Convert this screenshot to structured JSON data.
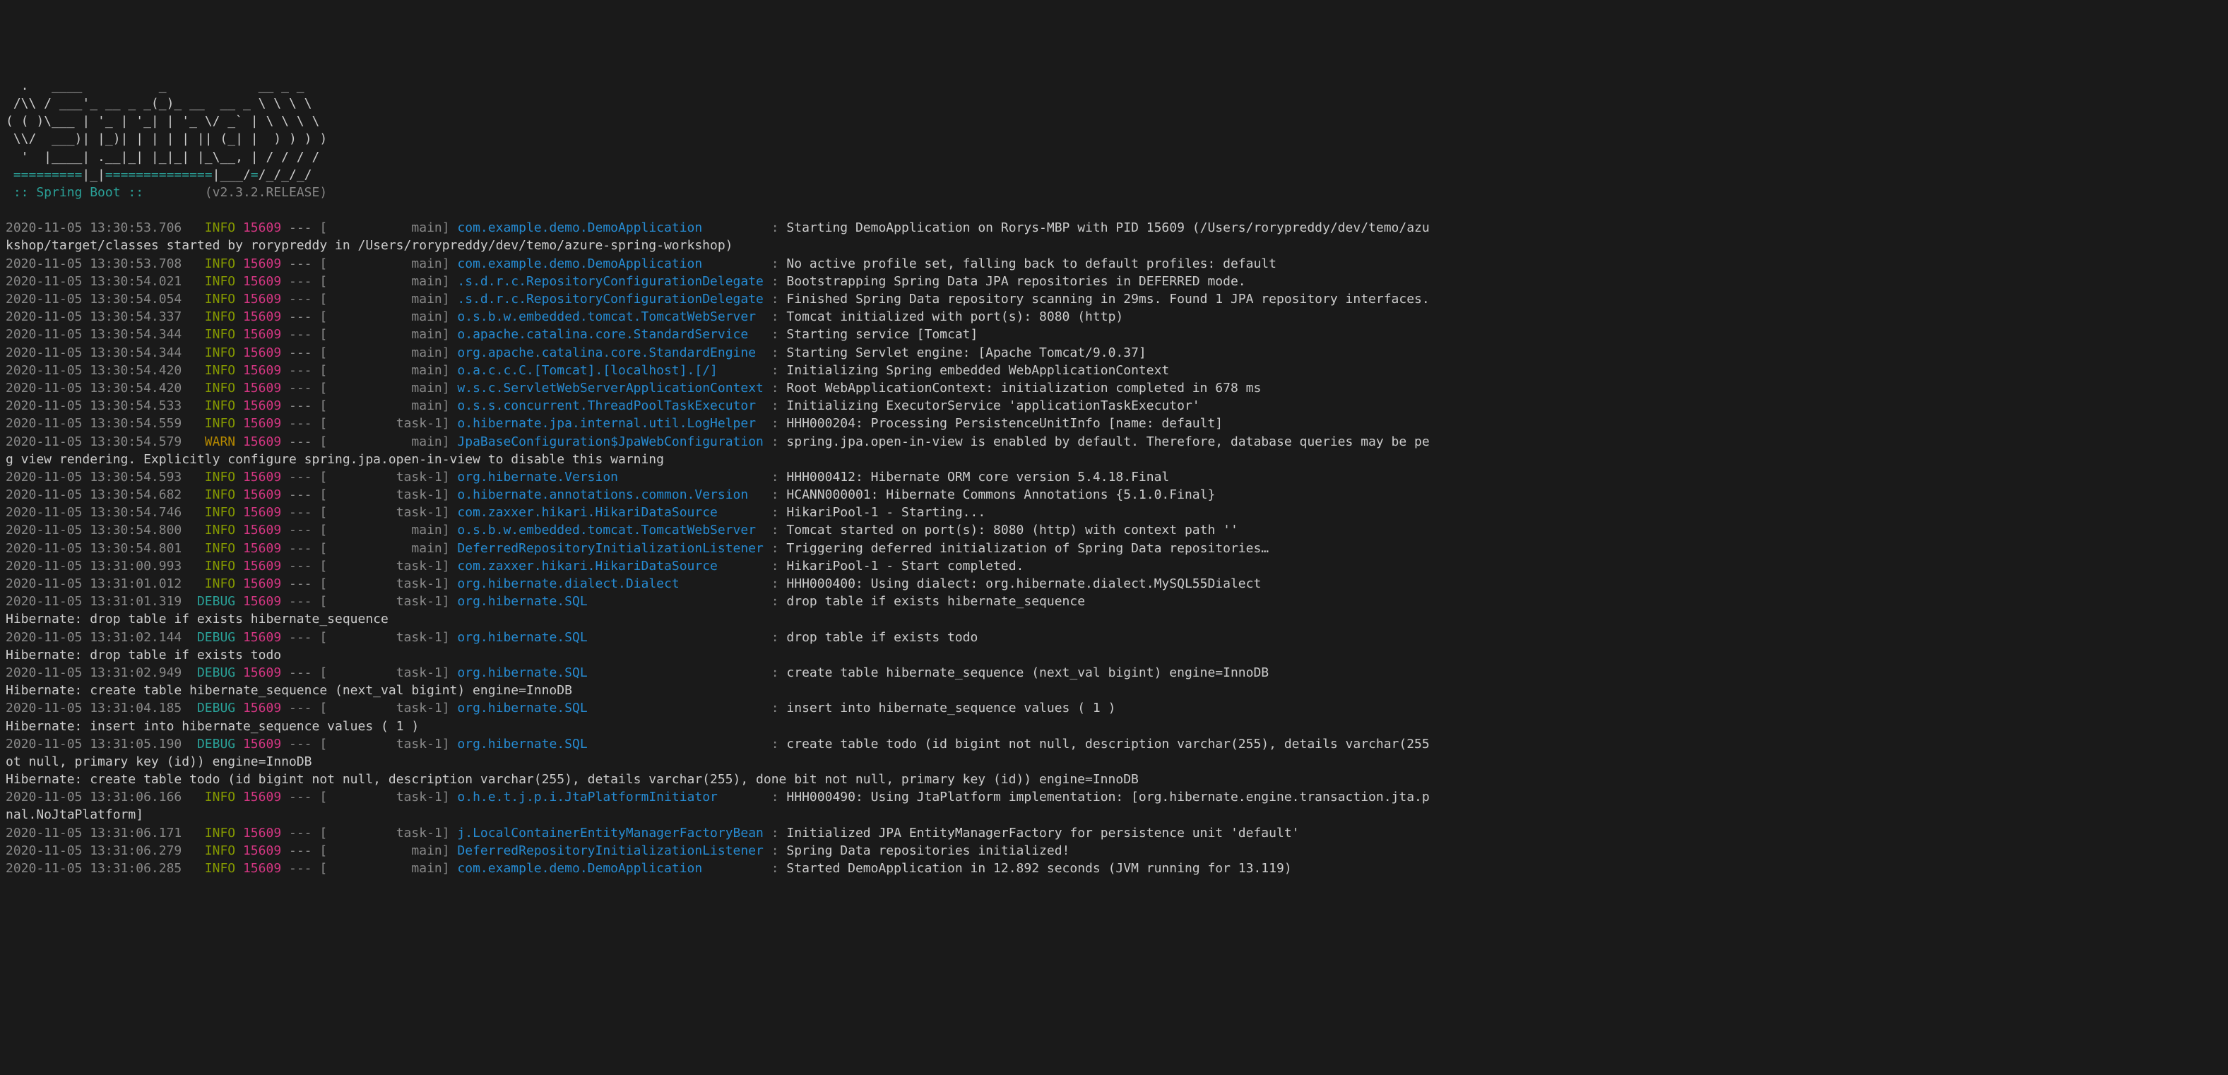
{
  "banner": {
    "line1": "  .   ____          _            __ _ _",
    "line2": " /\\\\ / ___'_ __ _ _(_)_ __  __ _ \\ \\ \\ \\",
    "line3": "( ( )\\___ | '_ | '_| | '_ \\/ _` | \\ \\ \\ \\",
    "line4": " \\\\/  ___)| |_)| | | | | || (_| |  ) ) ) )",
    "line5": "  '  |____| .__|_| |_|_| |_\\__, | / / / /",
    "eq": " =========",
    "eq2": "|_|",
    "eq3": "==============",
    "eq4": "|___/",
    "eq5": "=",
    "slashes": "/_/_/_/",
    "boot": " :: Spring Boot ::        ",
    "version": "(v2.3.2.RELEASE)"
  },
  "entries": [
    {
      "ts": "2020-11-05 13:30:53.706",
      "lvl": "INFO",
      "pid": "15609",
      "sep": "--- [",
      "thread": "           main]",
      "logger": "com.example.demo.DemoApplication        ",
      "msg": "Starting DemoApplication on Rorys-MBP with PID 15609 (/Users/rorypreddy/dev/temo/azu"
    },
    {
      "raw": "kshop/target/classes started by rorypreddy in /Users/rorypreddy/dev/temo/azure-spring-workshop)"
    },
    {
      "ts": "2020-11-05 13:30:53.708",
      "lvl": "INFO",
      "pid": "15609",
      "sep": "--- [",
      "thread": "           main]",
      "logger": "com.example.demo.DemoApplication        ",
      "msg": "No active profile set, falling back to default profiles: default"
    },
    {
      "ts": "2020-11-05 13:30:54.021",
      "lvl": "INFO",
      "pid": "15609",
      "sep": "--- [",
      "thread": "           main]",
      "logger": ".s.d.r.c.RepositoryConfigurationDelegate",
      "msg": "Bootstrapping Spring Data JPA repositories in DEFERRED mode."
    },
    {
      "ts": "2020-11-05 13:30:54.054",
      "lvl": "INFO",
      "pid": "15609",
      "sep": "--- [",
      "thread": "           main]",
      "logger": ".s.d.r.c.RepositoryConfigurationDelegate",
      "msg": "Finished Spring Data repository scanning in 29ms. Found 1 JPA repository interfaces."
    },
    {
      "ts": "2020-11-05 13:30:54.337",
      "lvl": "INFO",
      "pid": "15609",
      "sep": "--- [",
      "thread": "           main]",
      "logger": "o.s.b.w.embedded.tomcat.TomcatWebServer ",
      "msg": "Tomcat initialized with port(s): 8080 (http)"
    },
    {
      "ts": "2020-11-05 13:30:54.344",
      "lvl": "INFO",
      "pid": "15609",
      "sep": "--- [",
      "thread": "           main]",
      "logger": "o.apache.catalina.core.StandardService  ",
      "msg": "Starting service [Tomcat]"
    },
    {
      "ts": "2020-11-05 13:30:54.344",
      "lvl": "INFO",
      "pid": "15609",
      "sep": "--- [",
      "thread": "           main]",
      "logger": "org.apache.catalina.core.StandardEngine ",
      "msg": "Starting Servlet engine: [Apache Tomcat/9.0.37]"
    },
    {
      "ts": "2020-11-05 13:30:54.420",
      "lvl": "INFO",
      "pid": "15609",
      "sep": "--- [",
      "thread": "           main]",
      "logger": "o.a.c.c.C.[Tomcat].[localhost].[/]      ",
      "msg": "Initializing Spring embedded WebApplicationContext"
    },
    {
      "ts": "2020-11-05 13:30:54.420",
      "lvl": "INFO",
      "pid": "15609",
      "sep": "--- [",
      "thread": "           main]",
      "logger": "w.s.c.ServletWebServerApplicationContext",
      "msg": "Root WebApplicationContext: initialization completed in 678 ms"
    },
    {
      "ts": "2020-11-05 13:30:54.533",
      "lvl": "INFO",
      "pid": "15609",
      "sep": "--- [",
      "thread": "           main]",
      "logger": "o.s.s.concurrent.ThreadPoolTaskExecutor ",
      "msg": "Initializing ExecutorService 'applicationTaskExecutor'"
    },
    {
      "ts": "2020-11-05 13:30:54.559",
      "lvl": "INFO",
      "pid": "15609",
      "sep": "--- [",
      "thread": "         task-1]",
      "logger": "o.hibernate.jpa.internal.util.LogHelper ",
      "msg": "HHH000204: Processing PersistenceUnitInfo [name: default]"
    },
    {
      "ts": "2020-11-05 13:30:54.579",
      "lvl": "WARN",
      "pid": "15609",
      "sep": "--- [",
      "thread": "           main]",
      "logger": "JpaBaseConfiguration$JpaWebConfiguration",
      "msg": "spring.jpa.open-in-view is enabled by default. Therefore, database queries may be pe"
    },
    {
      "raw": "g view rendering. Explicitly configure spring.jpa.open-in-view to disable this warning"
    },
    {
      "ts": "2020-11-05 13:30:54.593",
      "lvl": "INFO",
      "pid": "15609",
      "sep": "--- [",
      "thread": "         task-1]",
      "logger": "org.hibernate.Version                   ",
      "msg": "HHH000412: Hibernate ORM core version 5.4.18.Final"
    },
    {
      "ts": "2020-11-05 13:30:54.682",
      "lvl": "INFO",
      "pid": "15609",
      "sep": "--- [",
      "thread": "         task-1]",
      "logger": "o.hibernate.annotations.common.Version  ",
      "msg": "HCANN000001: Hibernate Commons Annotations {5.1.0.Final}"
    },
    {
      "ts": "2020-11-05 13:30:54.746",
      "lvl": "INFO",
      "pid": "15609",
      "sep": "--- [",
      "thread": "         task-1]",
      "logger": "com.zaxxer.hikari.HikariDataSource      ",
      "msg": "HikariPool-1 - Starting..."
    },
    {
      "ts": "2020-11-05 13:30:54.800",
      "lvl": "INFO",
      "pid": "15609",
      "sep": "--- [",
      "thread": "           main]",
      "logger": "o.s.b.w.embedded.tomcat.TomcatWebServer ",
      "msg": "Tomcat started on port(s): 8080 (http) with context path ''"
    },
    {
      "ts": "2020-11-05 13:30:54.801",
      "lvl": "INFO",
      "pid": "15609",
      "sep": "--- [",
      "thread": "           main]",
      "logger": "DeferredRepositoryInitializationListener",
      "msg": "Triggering deferred initialization of Spring Data repositories…"
    },
    {
      "ts": "2020-11-05 13:31:00.993",
      "lvl": "INFO",
      "pid": "15609",
      "sep": "--- [",
      "thread": "         task-1]",
      "logger": "com.zaxxer.hikari.HikariDataSource      ",
      "msg": "HikariPool-1 - Start completed."
    },
    {
      "ts": "2020-11-05 13:31:01.012",
      "lvl": "INFO",
      "pid": "15609",
      "sep": "--- [",
      "thread": "         task-1]",
      "logger": "org.hibernate.dialect.Dialect           ",
      "msg": "HHH000400: Using dialect: org.hibernate.dialect.MySQL55Dialect"
    },
    {
      "ts": "2020-11-05 13:31:01.319",
      "lvl": "DEBUG",
      "pid": "15609",
      "sep": "--- [",
      "thread": "         task-1]",
      "logger": "org.hibernate.SQL                       ",
      "msg": "drop table if exists hibernate_sequence"
    },
    {
      "raw": "Hibernate: drop table if exists hibernate_sequence"
    },
    {
      "ts": "2020-11-05 13:31:02.144",
      "lvl": "DEBUG",
      "pid": "15609",
      "sep": "--- [",
      "thread": "         task-1]",
      "logger": "org.hibernate.SQL                       ",
      "msg": "drop table if exists todo"
    },
    {
      "raw": "Hibernate: drop table if exists todo"
    },
    {
      "ts": "2020-11-05 13:31:02.949",
      "lvl": "DEBUG",
      "pid": "15609",
      "sep": "--- [",
      "thread": "         task-1]",
      "logger": "org.hibernate.SQL                       ",
      "msg": "create table hibernate_sequence (next_val bigint) engine=InnoDB"
    },
    {
      "raw": "Hibernate: create table hibernate_sequence (next_val bigint) engine=InnoDB"
    },
    {
      "ts": "2020-11-05 13:31:04.185",
      "lvl": "DEBUG",
      "pid": "15609",
      "sep": "--- [",
      "thread": "         task-1]",
      "logger": "org.hibernate.SQL                       ",
      "msg": "insert into hibernate_sequence values ( 1 )"
    },
    {
      "raw": "Hibernate: insert into hibernate_sequence values ( 1 )"
    },
    {
      "ts": "2020-11-05 13:31:05.190",
      "lvl": "DEBUG",
      "pid": "15609",
      "sep": "--- [",
      "thread": "         task-1]",
      "logger": "org.hibernate.SQL                       ",
      "msg": "create table todo (id bigint not null, description varchar(255), details varchar(255"
    },
    {
      "raw": "ot null, primary key (id)) engine=InnoDB"
    },
    {
      "raw": "Hibernate: create table todo (id bigint not null, description varchar(255), details varchar(255), done bit not null, primary key (id)) engine=InnoDB"
    },
    {
      "ts": "2020-11-05 13:31:06.166",
      "lvl": "INFO",
      "pid": "15609",
      "sep": "--- [",
      "thread": "         task-1]",
      "logger": "o.h.e.t.j.p.i.JtaPlatformInitiator      ",
      "msg": "HHH000490: Using JtaPlatform implementation: [org.hibernate.engine.transaction.jta.p"
    },
    {
      "raw": "nal.NoJtaPlatform]"
    },
    {
      "ts": "2020-11-05 13:31:06.171",
      "lvl": "INFO",
      "pid": "15609",
      "sep": "--- [",
      "thread": "         task-1]",
      "logger": "j.LocalContainerEntityManagerFactoryBean",
      "msg": "Initialized JPA EntityManagerFactory for persistence unit 'default'"
    },
    {
      "ts": "2020-11-05 13:31:06.279",
      "lvl": "INFO",
      "pid": "15609",
      "sep": "--- [",
      "thread": "           main]",
      "logger": "DeferredRepositoryInitializationListener",
      "msg": "Spring Data repositories initialized!"
    },
    {
      "ts": "2020-11-05 13:31:06.285",
      "lvl": "INFO",
      "pid": "15609",
      "sep": "--- [",
      "thread": "           main]",
      "logger": "com.example.demo.DemoApplication        ",
      "msg": "Started DemoApplication in 12.892 seconds (JVM running for 13.119)"
    }
  ]
}
